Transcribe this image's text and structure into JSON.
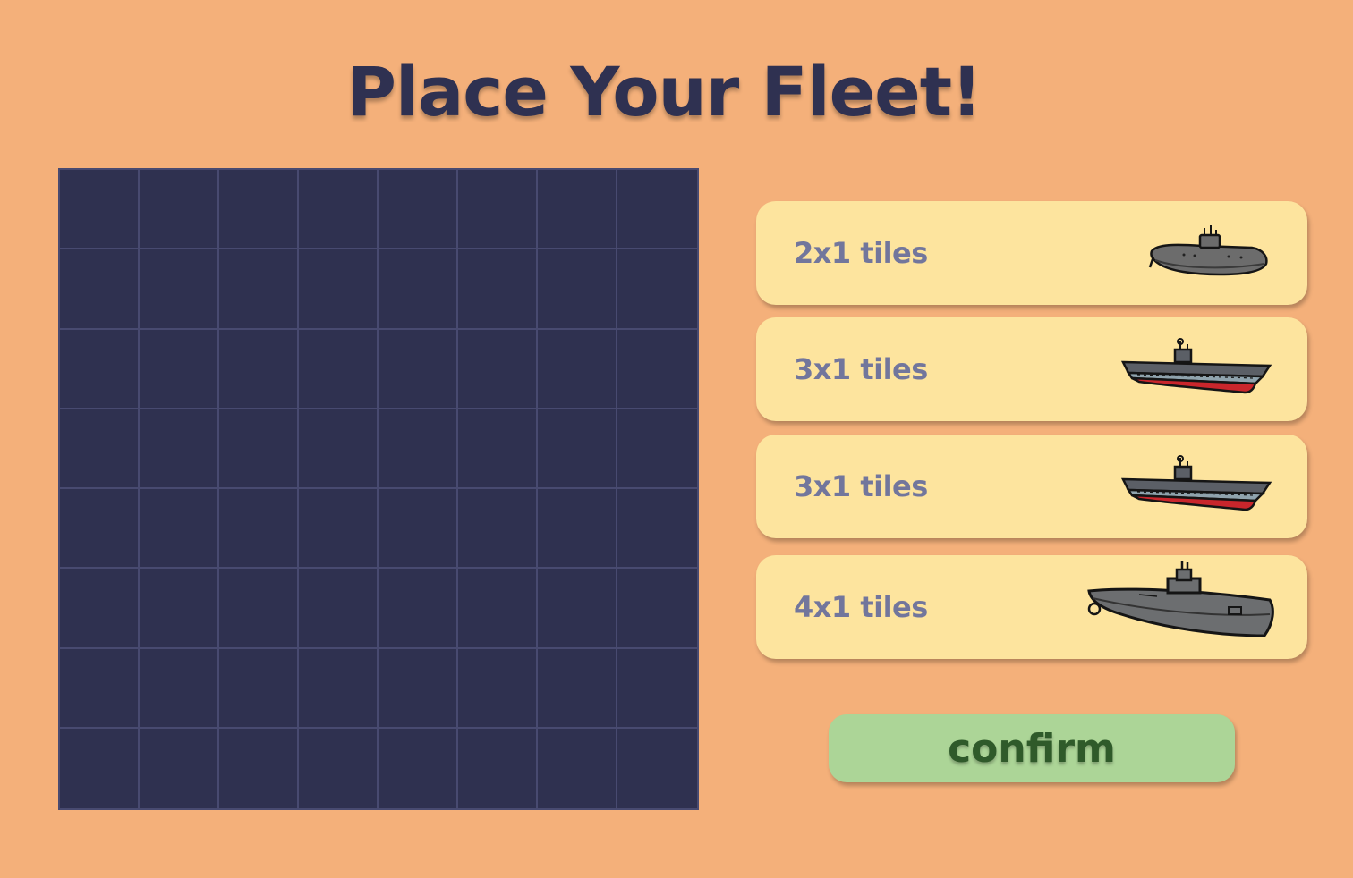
{
  "title": "Place Your Fleet!",
  "board": {
    "rows": 8,
    "cols": 8
  },
  "ships": [
    {
      "label": "2x1 tiles",
      "icon": "submarine-small-icon",
      "length": 2
    },
    {
      "label": "3x1 tiles",
      "icon": "aircraft-carrier-icon",
      "length": 3
    },
    {
      "label": "3x1 tiles",
      "icon": "aircraft-carrier-icon",
      "length": 3
    },
    {
      "label": "4x1 tiles",
      "icon": "submarine-large-icon",
      "length": 4
    }
  ],
  "confirm_label": "confirm",
  "colors": {
    "background": "#f4b07a",
    "title": "#2f3151",
    "board": "#2f3150",
    "grid_line": "#484a70",
    "card": "#fde49e",
    "card_text": "#72769c",
    "button": "#acd597",
    "button_text": "#2f5a2a"
  }
}
